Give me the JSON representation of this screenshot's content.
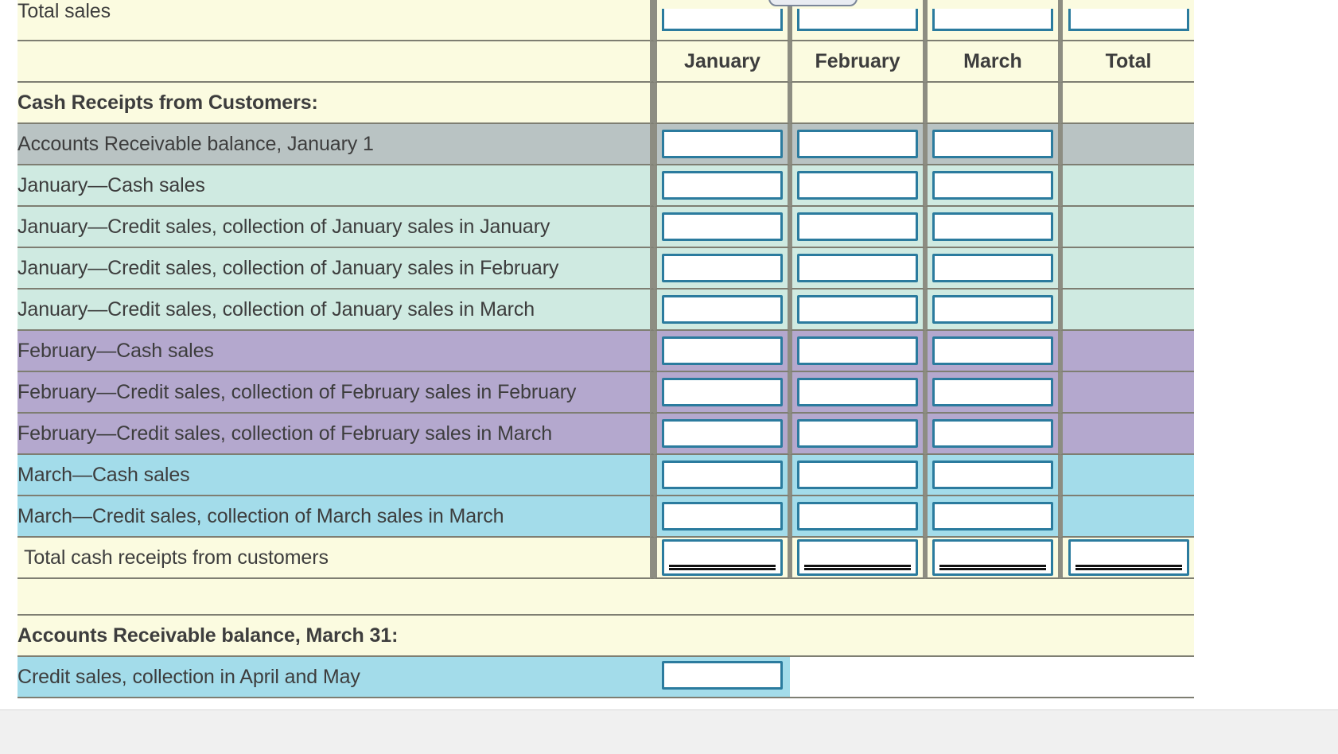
{
  "worksheet": {
    "title_row_label": "Total sales",
    "column_headers": [
      "January",
      "February",
      "March",
      "Total"
    ],
    "section_heading": "Cash Receipts from Customers:",
    "rows": [
      {
        "label": "Accounts Receivable balance, January 1",
        "tint": "gray",
        "inputs": 3
      },
      {
        "label": "January—Cash sales",
        "tint": "mint",
        "inputs": 3
      },
      {
        "label": "January—Credit sales, collection of January sales in January",
        "tint": "mint",
        "inputs": 3
      },
      {
        "label": "January—Credit sales, collection of January sales in February",
        "tint": "mint",
        "inputs": 3
      },
      {
        "label": "January—Credit sales, collection of January sales in March",
        "tint": "mint",
        "inputs": 3
      },
      {
        "label": "February—Cash sales",
        "tint": "purple",
        "inputs": 3
      },
      {
        "label": "February—Credit sales, collection of February sales in February",
        "tint": "purple",
        "inputs": 3
      },
      {
        "label": "February—Credit sales, collection of February sales in March",
        "tint": "purple",
        "inputs": 3
      },
      {
        "label": "March—Cash sales",
        "tint": "blue",
        "inputs": 3
      },
      {
        "label": "March—Credit sales, collection of March sales in March",
        "tint": "blue",
        "inputs": 3
      }
    ],
    "total_row": {
      "label": "Total cash receipts from customers",
      "tint": "yellow",
      "inputs": 4
    },
    "footer_heading": "Accounts Receivable balance, March 31:",
    "footer_row": {
      "label": "Credit sales, collection in April and May",
      "tint": "blue",
      "inputs": 1
    }
  },
  "colors": {
    "page_background": "#ffffff",
    "sheet_yellow": "#fbfbe0",
    "tint_gray": "#b9c3c3",
    "tint_mint": "#cfeae1",
    "tint_purple": "#b4a8ce",
    "tint_blue": "#a3dcea",
    "grid_line": "#7e7e72",
    "input_border": "#2b7b9e",
    "text": "#3d3d3d",
    "gutter": "#f0f0f0"
  }
}
